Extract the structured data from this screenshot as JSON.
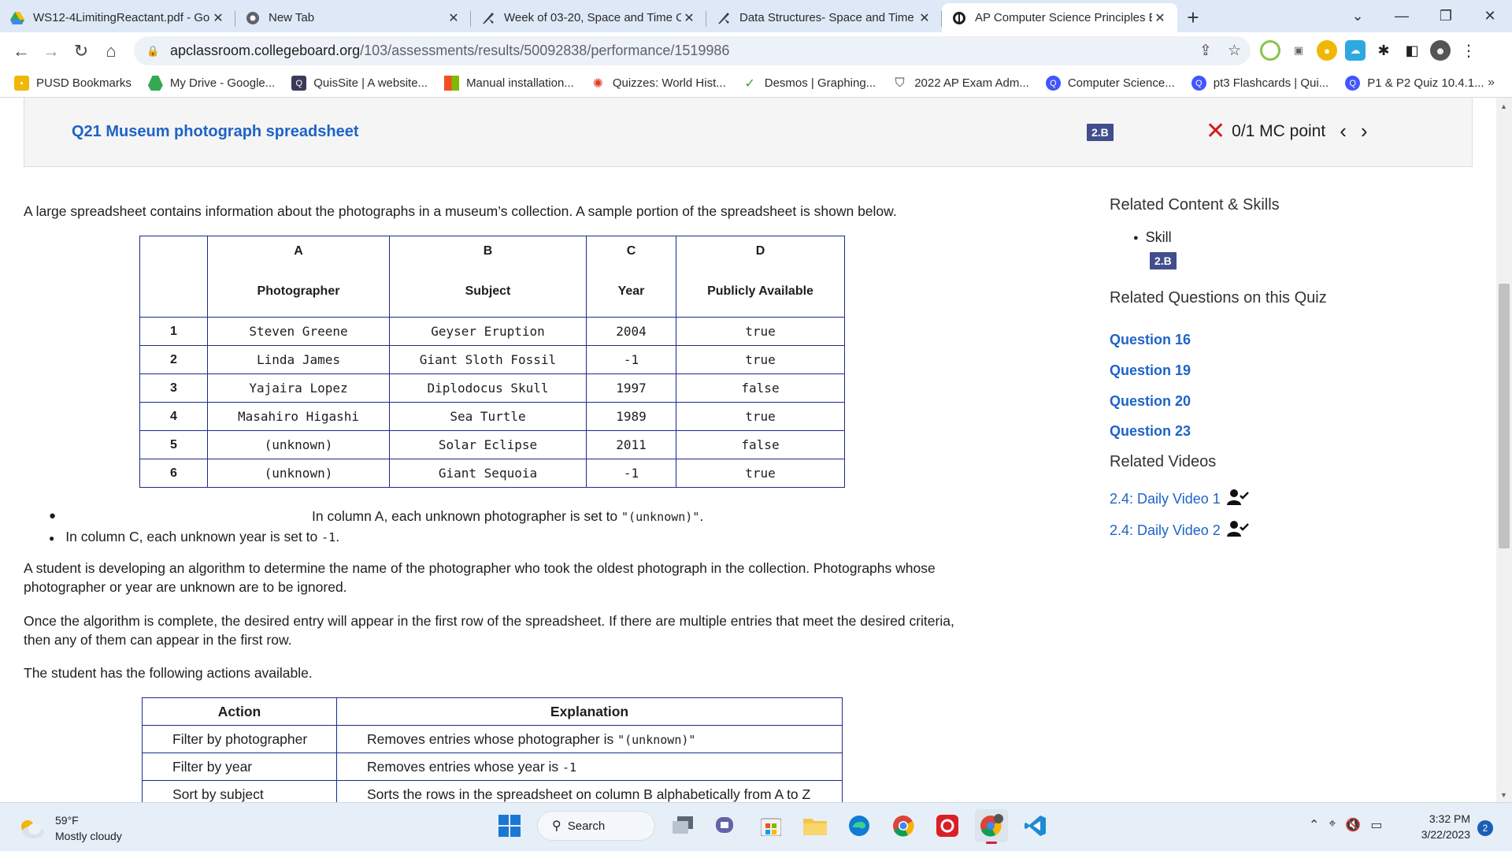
{
  "browser": {
    "tabs": [
      {
        "title": "WS12-4LimitingReactant.pdf - Go",
        "icon": "google-drive-icon",
        "active": false
      },
      {
        "title": "New Tab",
        "icon": "chrome-icon",
        "active": false
      },
      {
        "title": "Week of 03-20, Space and Time C",
        "icon": "quill-icon",
        "active": false
      },
      {
        "title": "Data Structures- Space and Time",
        "icon": "quill-icon",
        "active": false
      },
      {
        "title": "AP Computer Science Principles E",
        "icon": "collegeboard-icon",
        "active": true
      }
    ],
    "url_domain": "apclassroom.collegeboard.org",
    "url_path": "/103/assessments/results/50092838/performance/1519986",
    "bookmarks": [
      {
        "label": "PUSD Bookmarks",
        "icon": "folder-icon",
        "color": "#f2b705"
      },
      {
        "label": "My Drive - Google...",
        "icon": "google-drive-icon",
        "color": "#34a853"
      },
      {
        "label": "QuisSite | A website...",
        "icon": "quissite-icon",
        "color": "#3a3a5a"
      },
      {
        "label": "Manual installation...",
        "icon": "microsoft-icon",
        "color": "#f25022"
      },
      {
        "label": "Quizzes: World Hist...",
        "icon": "canvas-icon",
        "color": "#e33c2b"
      },
      {
        "label": "Desmos | Graphing...",
        "icon": "desmos-icon",
        "color": "#2f9e44"
      },
      {
        "label": "2022 AP Exam Adm...",
        "icon": "shield-icon",
        "color": "#444444"
      },
      {
        "label": "Computer Science...",
        "icon": "quizlet-icon",
        "color": "#4255ff"
      },
      {
        "label": "pt3 Flashcards | Qui...",
        "icon": "quizlet-icon",
        "color": "#4255ff"
      },
      {
        "label": "P1 & P2 Quiz 10.4.1...",
        "icon": "quizlet-icon",
        "color": "#4255ff"
      }
    ]
  },
  "question": {
    "title": "Q21 Museum photograph spreadsheet",
    "skill_badge": "2.B",
    "score": "0/1 MC point",
    "prompt": "A large spreadsheet contains information about the photographs in a museum’s collection. A sample portion of the spreadsheet is shown below."
  },
  "sheet": {
    "col_letters": [
      "A",
      "B",
      "C",
      "D"
    ],
    "col_names": [
      "Photographer",
      "Subject",
      "Year",
      "Publicly Available"
    ],
    "rows": [
      {
        "n": "1",
        "cells": [
          "Steven Greene",
          "Geyser Eruption",
          "2004",
          "true"
        ]
      },
      {
        "n": "2",
        "cells": [
          "Linda James",
          "Giant Sloth Fossil",
          "-1",
          "true"
        ]
      },
      {
        "n": "3",
        "cells": [
          "Yajaira Lopez",
          "Diplodocus Skull",
          "1997",
          "false"
        ]
      },
      {
        "n": "4",
        "cells": [
          "Masahiro Higashi",
          "Sea Turtle",
          "1989",
          "true"
        ]
      },
      {
        "n": "5",
        "cells": [
          "(unknown)",
          "Solar Eclipse",
          "2011",
          "false"
        ]
      },
      {
        "n": "6",
        "cells": [
          "(unknown)",
          "Giant Sequoia",
          "-1",
          "true"
        ]
      }
    ]
  },
  "bullets": {
    "b1_text": "In column A, each unknown photographer is set to ",
    "b1_code": "\"(unknown)\"",
    "b1_end": ".",
    "b2_text": "In column C, each unknown year is set to ",
    "b2_code": "-1",
    "b2_end": "."
  },
  "paragraphs": {
    "p1_line1": "A student is developing an algorithm to determine the name of the photographer who took the oldest photograph in the collection. Photographs whose",
    "p1_line2": "photographer or year are unknown are to be ignored.",
    "p2_line1": "Once the algorithm is complete, the desired entry will appear in the first row of the spreadsheet. If there are multiple entries that meet the desired criteria,",
    "p2_line2": "then any of them can appear in the first row.",
    "p3": "The student has the following actions available."
  },
  "actions": {
    "headers": [
      "Action",
      "Explanation"
    ],
    "rows": [
      {
        "action": "Filter by photographer",
        "explanation": "Removes entries whose photographer is ",
        "code": "\"(unknown)\""
      },
      {
        "action": "Filter by year",
        "explanation": "Removes entries whose year is ",
        "code": "-1"
      },
      {
        "action": "Sort by subject",
        "explanation": "Sorts the rows in the spreadsheet on column B alphabetically from A to Z",
        "code": ""
      }
    ]
  },
  "sidebar": {
    "related_content_heading": "Related Content & Skills",
    "skill_label": "Skill",
    "skill_badge": "2.B",
    "related_questions_heading": "Related Questions on this Quiz",
    "questions": [
      "Question 16",
      "Question 19",
      "Question 20",
      "Question 23"
    ],
    "related_videos_heading": "Related Videos",
    "videos": [
      "2.4: Daily Video 1",
      "2.4: Daily Video 2"
    ]
  },
  "taskbar": {
    "temperature": "59°F",
    "weather": "Mostly cloudy",
    "search_label": "Search",
    "time": "3:32 PM",
    "date": "3/22/2023",
    "notifications": "2"
  },
  "colors": {
    "link": "#1e63c7",
    "badge": "#404e8c",
    "wrong": "#d41a1a",
    "table_border": "#1c2a8a"
  }
}
